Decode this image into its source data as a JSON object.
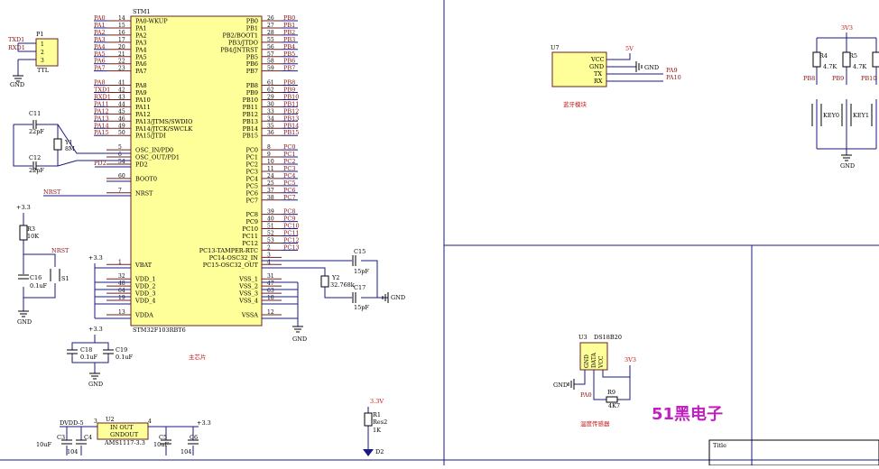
{
  "title_block": {
    "label": "Title"
  },
  "labels": {
    "gnd": "GND",
    "nrst": "NRST"
  },
  "mcu": {
    "designator": "STM1",
    "part": "STM32F103RBT6",
    "left_pins": [
      {
        "net": "PA0",
        "num": "14",
        "name": "PA0-WKUP"
      },
      {
        "net": "PA1",
        "num": "15",
        "name": "PA1"
      },
      {
        "net": "PA2",
        "num": "16",
        "name": "PA2"
      },
      {
        "net": "PA3",
        "num": "17",
        "name": "PA3"
      },
      {
        "net": "PA4",
        "num": "20",
        "name": "PA4"
      },
      {
        "net": "PA5",
        "num": "21",
        "name": "PA5"
      },
      {
        "net": "PA6",
        "num": "22",
        "name": "PA6"
      },
      {
        "net": "PA7",
        "num": "23",
        "name": "PA7"
      },
      {
        "net": "",
        "num": "",
        "name": ""
      },
      {
        "net": "PA8",
        "num": "41",
        "name": "PA8"
      },
      {
        "net": "TXD1",
        "num": "42",
        "name": "PA9"
      },
      {
        "net": "RXD1",
        "num": "43",
        "name": "PA10"
      },
      {
        "net": "PA11",
        "num": "44",
        "name": "PA11"
      },
      {
        "net": "PA12",
        "num": "45",
        "name": "PA12"
      },
      {
        "net": "PA13",
        "num": "46",
        "name": "PA13/JTMS/SWDIO"
      },
      {
        "net": "PA14",
        "num": "49",
        "name": "PA14/JTCK/SWCLK"
      },
      {
        "net": "PA15",
        "num": "50",
        "name": "PA15/JTDI"
      },
      {
        "net": "",
        "num": "",
        "name": ""
      },
      {
        "net": "",
        "num": "5",
        "name": "OSC_IN/PD0"
      },
      {
        "net": "",
        "num": "6",
        "name": "OSC_OUT/PD1"
      },
      {
        "net": "",
        "num": "54",
        "name": "PD2"
      },
      {
        "net": "",
        "num": "",
        "name": ""
      },
      {
        "net": "",
        "num": "60",
        "name": "BOOT0"
      },
      {
        "net": "",
        "num": "",
        "name": ""
      },
      {
        "net": "",
        "num": "7",
        "name": "NRST"
      },
      {
        "net": "",
        "num": "",
        "name": ""
      },
      {
        "net": "",
        "num": "",
        "name": ""
      },
      {
        "net": "",
        "num": "",
        "name": ""
      },
      {
        "net": "",
        "num": "",
        "name": ""
      },
      {
        "net": "",
        "num": "",
        "name": ""
      },
      {
        "net": "",
        "num": "",
        "name": ""
      },
      {
        "net": "",
        "num": "",
        "name": ""
      },
      {
        "net": "",
        "num": "",
        "name": ""
      },
      {
        "net": "",
        "num": "",
        "name": ""
      },
      {
        "net": "",
        "num": "1",
        "name": "VBAT"
      },
      {
        "net": "",
        "num": "",
        "name": ""
      },
      {
        "net": "",
        "num": "32",
        "name": "VDD_1"
      },
      {
        "net": "",
        "num": "48",
        "name": "VDD_2"
      },
      {
        "net": "",
        "num": "64",
        "name": "VDD_3"
      },
      {
        "net": "",
        "num": "19",
        "name": "VDD_4"
      },
      {
        "net": "",
        "num": "",
        "name": ""
      },
      {
        "net": "",
        "num": "13",
        "name": "VDDA"
      }
    ],
    "right_pins": [
      {
        "net": "PB0",
        "num": "26",
        "name": "PB0"
      },
      {
        "net": "PB1",
        "num": "27",
        "name": "PB1"
      },
      {
        "net": "PB2",
        "num": "28",
        "name": "PB2/BOOT1"
      },
      {
        "net": "PB3",
        "num": "55",
        "name": "PB3/JTDO"
      },
      {
        "net": "PB4",
        "num": "56",
        "name": "PB4/JNTRST"
      },
      {
        "net": "PB5",
        "num": "57",
        "name": "PB5"
      },
      {
        "net": "PB6",
        "num": "58",
        "name": "PB6"
      },
      {
        "net": "PB7",
        "num": "59",
        "name": "PB7"
      },
      {
        "net": "",
        "num": "",
        "name": ""
      },
      {
        "net": "PB8",
        "num": "61",
        "name": "PB8"
      },
      {
        "net": "PB9",
        "num": "62",
        "name": "PB9"
      },
      {
        "net": "PB10",
        "num": "29",
        "name": "PB10"
      },
      {
        "net": "PB11",
        "num": "30",
        "name": "PB11"
      },
      {
        "net": "PB12",
        "num": "33",
        "name": "PB12"
      },
      {
        "net": "PB13",
        "num": "34",
        "name": "PB13"
      },
      {
        "net": "PB14",
        "num": "35",
        "name": "PB14"
      },
      {
        "net": "PB15",
        "num": "36",
        "name": "PB15"
      },
      {
        "net": "",
        "num": "",
        "name": ""
      },
      {
        "net": "PC0",
        "num": "8",
        "name": "PC0"
      },
      {
        "net": "PC1",
        "num": "9",
        "name": "PC1"
      },
      {
        "net": "PC2",
        "num": "10",
        "name": "PC2"
      },
      {
        "net": "PC3",
        "num": "11",
        "name": "PC3"
      },
      {
        "net": "PC4",
        "num": "24",
        "name": "PC4"
      },
      {
        "net": "PC5",
        "num": "25",
        "name": "PC5"
      },
      {
        "net": "PC6",
        "num": "37",
        "name": "PC6"
      },
      {
        "net": "PC7",
        "num": "38",
        "name": "PC7"
      },
      {
        "net": "",
        "num": "",
        "name": ""
      },
      {
        "net": "PC8",
        "num": "39",
        "name": "PC8"
      },
      {
        "net": "PC9",
        "num": "40",
        "name": "PC9"
      },
      {
        "net": "PC10",
        "num": "51",
        "name": "PC10"
      },
      {
        "net": "PC11",
        "num": "52",
        "name": "PC11"
      },
      {
        "net": "PC12",
        "num": "53",
        "name": "PC12"
      },
      {
        "net": "PC13",
        "num": "2",
        "name": "PC13-TAMPER-RTC"
      },
      {
        "net": "",
        "num": "3",
        "name": "PC14-OSC32_IN"
      },
      {
        "net": "",
        "num": "4",
        "name": "PC15-OSC32_OUT"
      },
      {
        "net": "",
        "num": "",
        "name": ""
      },
      {
        "net": "",
        "num": "31",
        "name": "VSS_1"
      },
      {
        "net": "",
        "num": "47",
        "name": "VSS_2"
      },
      {
        "net": "",
        "num": "63",
        "name": "VSS_3"
      },
      {
        "net": "",
        "num": "18",
        "name": "VSS_4"
      },
      {
        "net": "",
        "num": "",
        "name": ""
      },
      {
        "net": "",
        "num": "12",
        "name": "VSSA"
      }
    ]
  },
  "p1": {
    "designator": "P1",
    "name": "TTL",
    "pins": [
      "1",
      "2",
      "3"
    ],
    "nets": [
      "TXD1",
      "RXD1"
    ]
  },
  "osc": {
    "c11": "C11",
    "c12": "C12",
    "c11_val": "22pF",
    "c12_val": "22pF",
    "y1": "Y1",
    "y1_val": "8M",
    "pd2_net": "PD2"
  },
  "reset": {
    "vcc": "+3.3",
    "r3": "R3",
    "r3_val": "10K",
    "c16": "C16",
    "c16_val": "0.1uF",
    "s1": "S1"
  },
  "power": {
    "v33": "+3.3",
    "c18": "C18",
    "c18_val": "0.1uF",
    "c19": "C19",
    "c19_val": "0.1uF"
  },
  "rtc": {
    "c15": "C15",
    "c15_val": "15pF",
    "c17": "C17",
    "c17_val": "15pF",
    "y2": "Y2",
    "y2_val": "32.768k"
  },
  "ldo": {
    "designator": "U2",
    "in_out": "IN   OUT",
    "gnd_out": "GNDOUT",
    "part": "AMS1117-3.3",
    "vin": "DVDD-5",
    "pin3": "3",
    "pin4": "4",
    "c3": "C3",
    "c3_val": "10uF",
    "c4": "C4",
    "c4_val": "104",
    "c5": "C5",
    "c5_val": "10uF",
    "c6": "C6",
    "c6_val": "104"
  },
  "led": {
    "vcc": "3.3V",
    "r1": "R1",
    "r1_part": "Res2",
    "r1_val": "1K",
    "d2": "D2"
  },
  "bt": {
    "designator": "U7",
    "pins": [
      "VCC",
      "GND",
      "TX",
      "RX"
    ],
    "vcc": "5V",
    "nets": [
      "PA9",
      "PA10"
    ]
  },
  "keys": {
    "vcc": "3V3",
    "r4": "R4",
    "r4_val": "4.7K",
    "r5": "R5",
    "r5_val": "4.7K",
    "nets": [
      "PB8",
      "PB9",
      "PB10"
    ],
    "key0": "KEY0",
    "key1": "KEY1"
  },
  "temp": {
    "designator": "U3",
    "part": "DS18B20",
    "pins": [
      "GND",
      "DATA",
      "VCC"
    ],
    "vcc": "3V3",
    "net": "PA0",
    "r9": "R9",
    "r9_val": "4K7"
  },
  "captions": {
    "main_chip": "主芯片",
    "bluetooth": "蓝牙模块",
    "temp_sensor": "温度传感器"
  },
  "brand": {
    "logo": "51黑电子"
  }
}
